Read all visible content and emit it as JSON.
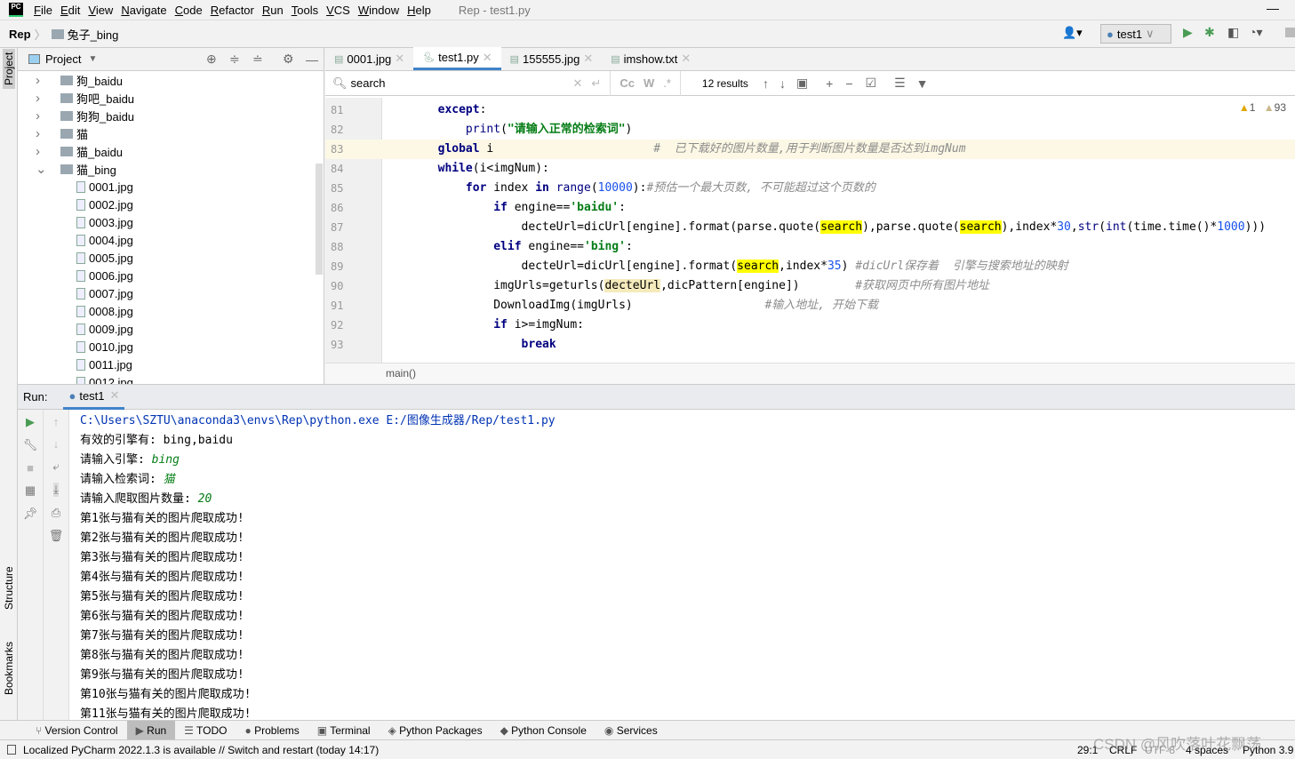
{
  "menu": {
    "items": [
      "File",
      "Edit",
      "View",
      "Navigate",
      "Code",
      "Refactor",
      "Run",
      "Tools",
      "VCS",
      "Window",
      "Help"
    ],
    "window_title": "Rep - test1.py"
  },
  "nav": {
    "project": "Rep",
    "folder": "兔子_bing",
    "run_config": "test1"
  },
  "stripe": {
    "project": "Project",
    "structure": "Structure",
    "bookmarks": "Bookmarks"
  },
  "project_panel": {
    "title": "Project",
    "tree": [
      {
        "label": "狗_baidu",
        "type": "folder",
        "expanded": false
      },
      {
        "label": "狗吧_baidu",
        "type": "folder",
        "expanded": false
      },
      {
        "label": "狗狗_baidu",
        "type": "folder",
        "expanded": false
      },
      {
        "label": "猫",
        "type": "folder",
        "expanded": false
      },
      {
        "label": "猫_baidu",
        "type": "folder",
        "expanded": false
      },
      {
        "label": "猫_bing",
        "type": "folder",
        "expanded": true
      },
      {
        "label": "0001.jpg",
        "type": "file"
      },
      {
        "label": "0002.jpg",
        "type": "file"
      },
      {
        "label": "0003.jpg",
        "type": "file"
      },
      {
        "label": "0004.jpg",
        "type": "file"
      },
      {
        "label": "0005.jpg",
        "type": "file"
      },
      {
        "label": "0006.jpg",
        "type": "file"
      },
      {
        "label": "0007.jpg",
        "type": "file"
      },
      {
        "label": "0008.jpg",
        "type": "file"
      },
      {
        "label": "0009.jpg",
        "type": "file"
      },
      {
        "label": "0010.jpg",
        "type": "file"
      },
      {
        "label": "0011.jpg",
        "type": "file"
      },
      {
        "label": "0012.jpg",
        "type": "file"
      }
    ]
  },
  "editor": {
    "tabs": [
      {
        "label": "0001.jpg",
        "active": false
      },
      {
        "label": "test1.py",
        "active": true
      },
      {
        "label": "155555.jpg",
        "active": false
      },
      {
        "label": "imshow.txt",
        "active": false
      }
    ],
    "find": {
      "query": "search",
      "results": "12 results",
      "cc": "Cc",
      "w": "W",
      "regex": ".*"
    },
    "warnings": {
      "warn": "1",
      "weak": "93"
    },
    "breadcrumb": "main()",
    "lines": [
      {
        "n": "81",
        "t": [
          [
            "        ",
            ""
          ],
          [
            "except",
            "kw"
          ],
          [
            ":",
            ""
          ]
        ]
      },
      {
        "n": "82",
        "t": [
          [
            "            ",
            ""
          ],
          [
            "print",
            "bi"
          ],
          [
            "(",
            ""
          ],
          [
            "\"请输入正常的检索词\"",
            "str"
          ],
          [
            ")",
            ""
          ]
        ]
      },
      {
        "n": "83",
        "cur": true,
        "t": [
          [
            "        ",
            ""
          ],
          [
            "global",
            "kw"
          ],
          [
            " i                       ",
            ""
          ],
          [
            "#  已下载好的图片数量,用于判断图片数量是否达到imgNum",
            "cmt"
          ]
        ]
      },
      {
        "n": "84",
        "t": [
          [
            "        ",
            ""
          ],
          [
            "while",
            "kw"
          ],
          [
            "(i<imgNum):",
            ""
          ]
        ]
      },
      {
        "n": "85",
        "t": [
          [
            "            ",
            ""
          ],
          [
            "for",
            "kw"
          ],
          [
            " index ",
            ""
          ],
          [
            "in",
            "kw"
          ],
          [
            " ",
            ""
          ],
          [
            "range",
            "bi"
          ],
          [
            "(",
            ""
          ],
          [
            "10000",
            "num"
          ],
          [
            "):",
            ""
          ],
          [
            "#预估一个最大页数, 不可能超过这个页数的",
            "cmt"
          ]
        ]
      },
      {
        "n": "86",
        "t": [
          [
            "                ",
            ""
          ],
          [
            "if",
            "kw"
          ],
          [
            " engine==",
            ""
          ],
          [
            "'baidu'",
            "str"
          ],
          [
            ":",
            ""
          ]
        ]
      },
      {
        "n": "87",
        "t": [
          [
            "                    decteUrl=dicUrl[engine].format(parse.quote(",
            ""
          ],
          [
            "search",
            "hl"
          ],
          [
            "),parse.quote(",
            ""
          ],
          [
            "search",
            "hl"
          ],
          [
            "),index*",
            ""
          ],
          [
            "30",
            "num"
          ],
          [
            ",",
            ""
          ],
          [
            "str",
            "bi"
          ],
          [
            "(",
            ""
          ],
          [
            "int",
            "bi"
          ],
          [
            "(time.time()*",
            ""
          ],
          [
            "1000",
            "num"
          ],
          [
            ")))",
            ""
          ]
        ]
      },
      {
        "n": "88",
        "t": [
          [
            "                ",
            ""
          ],
          [
            "elif",
            "kw"
          ],
          [
            " engine==",
            ""
          ],
          [
            "'bing'",
            "str"
          ],
          [
            ":",
            ""
          ]
        ]
      },
      {
        "n": "89",
        "t": [
          [
            "                    decteUrl=dicUrl[engine].format(",
            ""
          ],
          [
            "search",
            "hl"
          ],
          [
            ",index*",
            ""
          ],
          [
            "35",
            "num"
          ],
          [
            ") ",
            ""
          ],
          [
            "#dicUrl保存着  引擎与搜索地址的映射",
            "cmt"
          ]
        ]
      },
      {
        "n": "90",
        "t": [
          [
            "                imgUrls=geturls(",
            ""
          ],
          [
            "decteUrl",
            "hl2"
          ],
          [
            ",dicPattern[engine])        ",
            ""
          ],
          [
            "#获取网页中所有图片地址",
            "cmt"
          ]
        ]
      },
      {
        "n": "91",
        "t": [
          [
            "                DownloadImg(imgUrls)                   ",
            ""
          ],
          [
            "#输入地址, 开始下载",
            "cmt"
          ]
        ]
      },
      {
        "n": "92",
        "t": [
          [
            "                ",
            ""
          ],
          [
            "if",
            "kw"
          ],
          [
            " i>=imgNum:",
            ""
          ]
        ]
      },
      {
        "n": "93",
        "t": [
          [
            "                    ",
            ""
          ],
          [
            "break",
            "kw"
          ]
        ]
      }
    ]
  },
  "run": {
    "label": "Run:",
    "tab": "test1",
    "console": [
      {
        "text": "C:\\Users\\SZTU\\anaconda3\\envs\\Rep\\python.exe E:/图像生成器/Rep/test1.py",
        "color": "#0033b3"
      },
      {
        "text": "有效的引擎有: bing,baidu"
      },
      {
        "text": "请输入引擎: ",
        "input": "bing"
      },
      {
        "text": "请输入检索词: ",
        "input": "猫"
      },
      {
        "text": "请输入爬取图片数量: ",
        "input": "20"
      },
      {
        "text": "第1张与猫有关的图片爬取成功!"
      },
      {
        "text": "第2张与猫有关的图片爬取成功!"
      },
      {
        "text": "第3张与猫有关的图片爬取成功!"
      },
      {
        "text": "第4张与猫有关的图片爬取成功!"
      },
      {
        "text": "第5张与猫有关的图片爬取成功!"
      },
      {
        "text": "第6张与猫有关的图片爬取成功!"
      },
      {
        "text": "第7张与猫有关的图片爬取成功!"
      },
      {
        "text": "第8张与猫有关的图片爬取成功!"
      },
      {
        "text": "第9张与猫有关的图片爬取成功!"
      },
      {
        "text": "第10张与猫有关的图片爬取成功!"
      },
      {
        "text": "第11张与猫有关的图片爬取成功!"
      }
    ]
  },
  "bottom_tools": [
    {
      "label": "Version Control"
    },
    {
      "label": "Run",
      "active": true
    },
    {
      "label": "TODO"
    },
    {
      "label": "Problems"
    },
    {
      "label": "Terminal"
    },
    {
      "label": "Python Packages"
    },
    {
      "label": "Python Console"
    },
    {
      "label": "Services"
    }
  ],
  "status": {
    "message": "Localized PyCharm 2022.1.3 is available // Switch and restart (today 14:17)",
    "position": "29:1",
    "line_sep": "CRLF",
    "encoding": "UTF-8",
    "indent": "4 spaces",
    "interpreter": "Python 3.9",
    "watermark": "CSDN @风吹落叶花飘荡"
  },
  "colors": {
    "accent": "#4083c9",
    "run_green": "#499c54",
    "highlight": "#ffff00"
  }
}
